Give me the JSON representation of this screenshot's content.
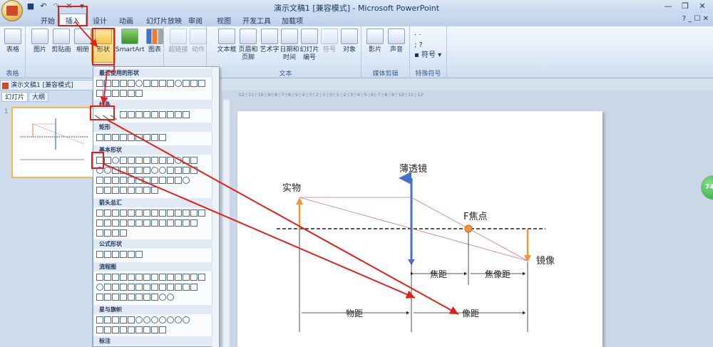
{
  "window": {
    "title": "演示文稿1 [兼容模式] - Microsoft PowerPoint"
  },
  "tabs": [
    "开始",
    "插入",
    "设计",
    "动画",
    "幻灯片放映",
    "审阅",
    "视图",
    "开发工具",
    "加载项"
  ],
  "active_tab": "插入",
  "ribbon": {
    "groups": {
      "tables": "表格",
      "text": "文本",
      "media": "媒体剪辑",
      "special": "特殊符号"
    },
    "buttons": {
      "table": "表格",
      "picture": "图片",
      "clipart": "剪贴画",
      "album": "相册",
      "shapes": "形状",
      "smartart": "SmartArt",
      "chart": "图表",
      "hyperlink": "超链接",
      "action": "动作",
      "textbox": "文本框",
      "header_footer_1": "页眉和",
      "header_footer_2": "页脚",
      "wordart": "艺术字",
      "datetime_1": "日期和",
      "datetime_2": "时间",
      "slide_number_1": "幻灯片",
      "slide_number_2": "编号",
      "symbol": "符号",
      "object": "对象",
      "movie": "影片",
      "sound": "声音",
      "special_symbol": "符号"
    }
  },
  "document_tab": "演示文稿1 [兼容模式]",
  "panel_tabs": {
    "slides": "幻灯片",
    "outline": "大纲"
  },
  "slide_number": "1",
  "shapes_menu": {
    "sections": [
      "最近使用的形状",
      "线条",
      "矩形",
      "基本形状",
      "箭头总汇",
      "公式形状",
      "流程图",
      "星与旗帜",
      "标注"
    ]
  },
  "ruler_text": "·12·¦·11·¦·10·¦·9·¦·8·¦·7·¦·6·¦·5·¦·4·¦·3·¦·2·¦·1·¦·0·¦·1·¦·2·¦·3·¦·4·¦·5·¦·6·¦·7·¦·8·¦·9·¦·10·¦·11·¦·12·",
  "diagram": {
    "lens_label": "薄透镜",
    "object_label": "实物",
    "focus_label": "F焦点",
    "image_label": "镜像",
    "focal_length": "焦距",
    "focal_image_distance": "焦像距",
    "object_distance": "物距",
    "image_distance": "像距"
  },
  "side_bubble": "74",
  "colors": {
    "annotation_red": "#e0201b",
    "lens_blue": "#4472c4",
    "arrow_orange": "#f0963c",
    "ray_pink": "#c97b86"
  }
}
